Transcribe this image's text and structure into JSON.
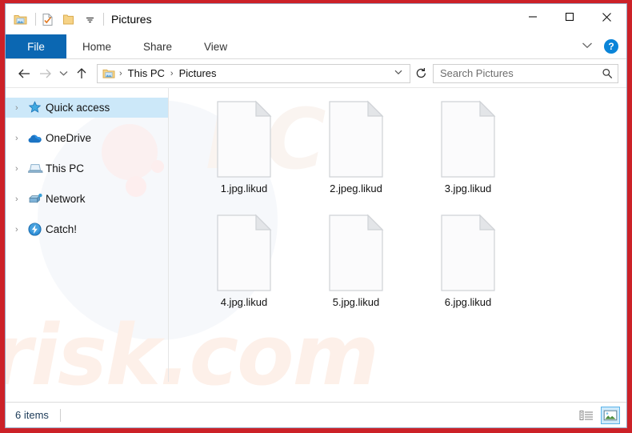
{
  "window": {
    "title": "Pictures",
    "quick_access_toolbar": [
      {
        "name": "pictures-folder-icon",
        "label": "Pictures"
      },
      {
        "name": "properties-icon",
        "label": "Properties"
      },
      {
        "name": "new-folder-icon",
        "label": "New folder"
      },
      {
        "name": "customize-qat-dropdown-icon",
        "label": "Customize Quick Access Toolbar"
      }
    ],
    "controls": {
      "minimize": "–",
      "maximize": "□",
      "close": "✕",
      "ribbon_collapse": "⌄",
      "help": "?"
    }
  },
  "ribbon": {
    "tabs": [
      {
        "label": "File",
        "active": true
      },
      {
        "label": "Home",
        "active": false
      },
      {
        "label": "Share",
        "active": false
      },
      {
        "label": "View",
        "active": false
      }
    ]
  },
  "address_bar": {
    "back": "←",
    "forward": "→",
    "recent": "∨",
    "up": "↑",
    "refresh": "↻",
    "breadcrumb": [
      "This PC",
      "Pictures"
    ],
    "breadcrumb_separator": "›",
    "breadcrumb_dropdown": "∨"
  },
  "search": {
    "placeholder": "Search Pictures",
    "icon": "search-icon"
  },
  "sidebar": {
    "items": [
      {
        "label": "Quick access",
        "icon": "star-icon",
        "selected": true
      },
      {
        "label": "OneDrive",
        "icon": "cloud-icon",
        "selected": false
      },
      {
        "label": "This PC",
        "icon": "computer-icon",
        "selected": false
      },
      {
        "label": "Network",
        "icon": "network-icon",
        "selected": false
      },
      {
        "label": "Catch!",
        "icon": "lightning-icon",
        "selected": false
      }
    ],
    "expand_chevron": "›"
  },
  "files": [
    {
      "name": "1.jpg.likud"
    },
    {
      "name": "2.jpeg.likud"
    },
    {
      "name": "3.jpg.likud"
    },
    {
      "name": "4.jpg.likud"
    },
    {
      "name": "5.jpg.likud"
    },
    {
      "name": "6.jpg.likud"
    }
  ],
  "status_bar": {
    "items_count": "6 items",
    "views": [
      {
        "name": "details-view-button",
        "active": false
      },
      {
        "name": "large-icons-view-button",
        "active": true
      }
    ]
  },
  "watermark": {
    "main": "risk.com",
    "upper": "PC"
  },
  "colors": {
    "ransom_border": "#cc2128",
    "ribbon_active": "#0b67b2",
    "selection": "#cce8f9",
    "help_badge": "#0a84d8"
  }
}
